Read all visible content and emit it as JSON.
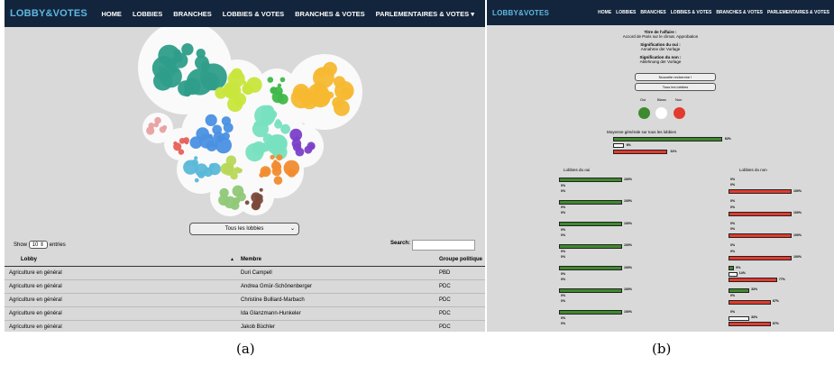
{
  "brand": "LOBBY&VOTES",
  "nav": [
    "HOME",
    "LOBBIES",
    "BRANCHES",
    "LOBBIES & VOTES",
    "BRANCHES & VOTES",
    "PARLEMENTAIRES & VOTES ▾"
  ],
  "nav_b": [
    "HOME",
    "LOBBIES",
    "BRANCHES",
    "LOBBIES & VOTES",
    "BRANCHES & VOTES",
    "PARLEMENTAIRES & VOTES"
  ],
  "panel_a": {
    "filter_select": "Tous les lobbies",
    "show_label": "Show",
    "entries_value": "10",
    "entries_label": "entries",
    "search_label": "Search:",
    "columns": [
      "Lobby",
      "Membre",
      "Groupe politique"
    ],
    "rows": [
      [
        "Agriculture en général",
        "Duri Campell",
        "PBD"
      ],
      [
        "Agriculture en général",
        "Andrea Gmür-Schönenberger",
        "PDC"
      ],
      [
        "Agriculture en général",
        "Christine Bulliard-Marbach",
        "PDC"
      ],
      [
        "Agriculture en général",
        "Ida Glanzmann-Hunkeler",
        "PDC"
      ],
      [
        "Agriculture en général",
        "Jakob Büchler",
        "PDC"
      ]
    ],
    "bubble_colors": [
      "#2e9e8a",
      "#c8e63c",
      "#3fb84a",
      "#f5b830",
      "#e8605a",
      "#e8a0a0",
      "#4a90e2",
      "#78e0c0",
      "#7b40c8",
      "#5ab8d8",
      "#b8d85a",
      "#f08c30",
      "#90c878",
      "#7a4a3a"
    ]
  },
  "panel_b": {
    "title_label": "Titre de l'affaire :",
    "title_value": "Accord de Paris sur le climat. Approbation",
    "oui_label": "Signification du oui :",
    "oui_value": "Annahme der Vorlage",
    "non_label": "Signification du non :",
    "non_value": "Ablehnung der Vorlage",
    "btn_new": "Nouvelle recherche !",
    "btn_all": "Tous les lobbies",
    "legend": [
      "Oui",
      "Blanc",
      "Non"
    ],
    "legend_colors": [
      "#3e8a2e",
      "#ffffff",
      "#e23b2e"
    ],
    "avg_title": "Moyenne générale sur tous les lobbies",
    "avg_values": [
      62,
      6,
      31
    ],
    "avg_labels": [
      "62%",
      "6%",
      "31%"
    ],
    "left_title": "Lobbies du oui",
    "right_title": "Lobbies du non",
    "left_rows": [
      {
        "oui": "100%",
        "blanc": "0%",
        "non": "0%"
      },
      {
        "oui": "100%",
        "blanc": "0%",
        "non": "0%"
      },
      {
        "oui": "100%",
        "blanc": "0%",
        "non": "0%"
      },
      {
        "oui": "100%",
        "blanc": "0%",
        "non": "0%"
      },
      {
        "oui": "100%",
        "blanc": "0%",
        "non": "0%"
      },
      {
        "oui": "100%",
        "blanc": "0%",
        "non": "0%"
      },
      {
        "oui": "100%",
        "blanc": "0%",
        "non": "0%"
      }
    ],
    "right_rows": [
      {
        "oui": "0%",
        "blanc": "0%",
        "non": "100%",
        "ov": 0,
        "bv": 0,
        "nv": 100
      },
      {
        "oui": "0%",
        "blanc": "0%",
        "non": "100%",
        "ov": 0,
        "bv": 0,
        "nv": 100
      },
      {
        "oui": "0%",
        "blanc": "0%",
        "non": "100%",
        "ov": 0,
        "bv": 0,
        "nv": 100
      },
      {
        "oui": "0%",
        "blanc": "0%",
        "non": "100%",
        "ov": 0,
        "bv": 0,
        "nv": 100
      },
      {
        "oui": "9%",
        "blanc": "14%",
        "non": "77%",
        "ov": 9,
        "bv": 14,
        "nv": 77
      },
      {
        "oui": "33%",
        "blanc": "0%",
        "non": "67%",
        "ov": 33,
        "bv": 0,
        "nv": 67
      },
      {
        "oui": "0%",
        "blanc": "33%",
        "non": "67%",
        "ov": 0,
        "bv": 33,
        "nv": 67
      }
    ]
  },
  "captions": [
    "(a)",
    "(b)"
  ]
}
